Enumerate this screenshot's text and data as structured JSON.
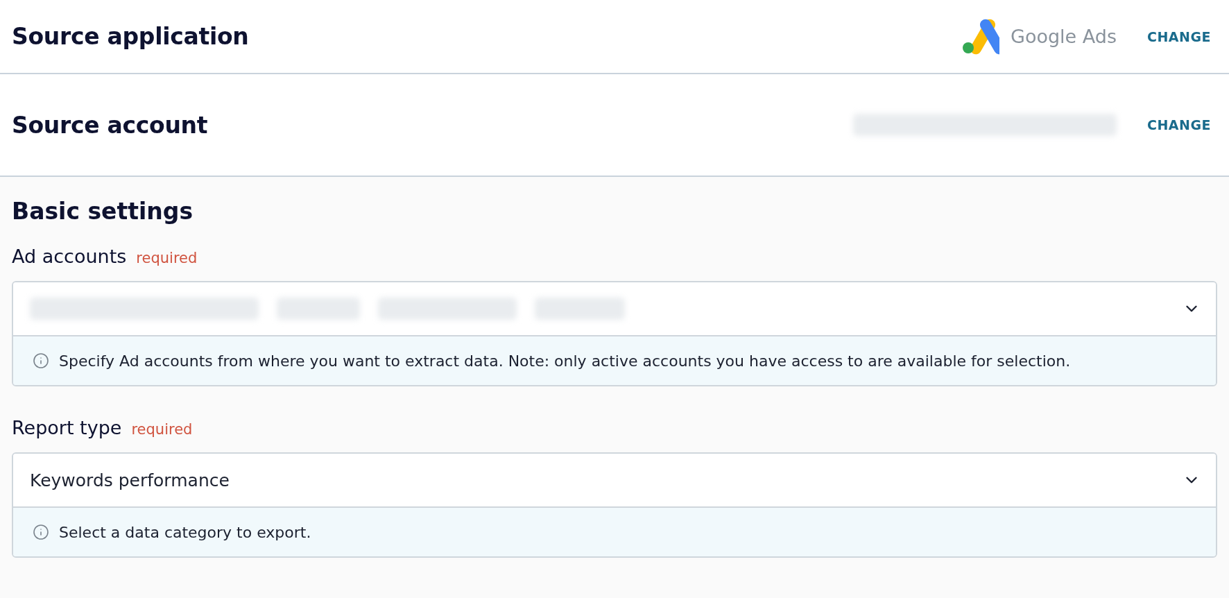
{
  "source_application": {
    "title": "Source application",
    "app_name": "Google Ads",
    "action": "CHANGE"
  },
  "source_account": {
    "title": "Source account",
    "action": "CHANGE"
  },
  "basic_settings": {
    "title": "Basic settings",
    "fields": [
      {
        "kind": "chips",
        "label": "Ad accounts",
        "required_label": "required",
        "hint": "Specify Ad accounts from where you want to extract data. Note: only active accounts you have access to are available for selection."
      },
      {
        "kind": "select",
        "label": "Report type",
        "required_label": "required",
        "value": "Keywords performance",
        "hint": "Select a data category to export."
      }
    ]
  }
}
